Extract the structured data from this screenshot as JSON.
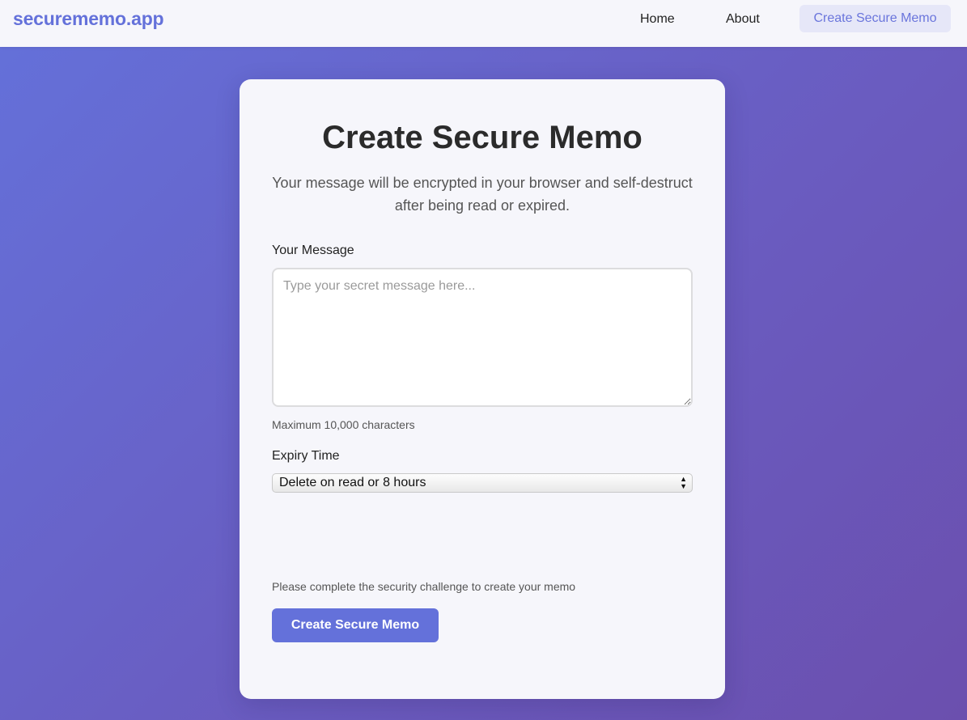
{
  "header": {
    "brand": "securememo.app",
    "nav": {
      "home": "Home",
      "about": "About",
      "create": "Create Secure Memo"
    }
  },
  "form": {
    "title": "Create Secure Memo",
    "subtitle": "Your message will be encrypted in your browser and self-destruct after being read or expired.",
    "message_label": "Your Message",
    "message_value": "",
    "message_placeholder": "Type your secret message here...",
    "message_hint": "Maximum 10,000 characters",
    "expiry_label": "Expiry Time",
    "expiry_selected": "Delete on read or 8 hours",
    "challenge_text": "Please complete the security challenge to create your memo",
    "submit_label": "Create Secure Memo"
  },
  "colors": {
    "accent": "#6471da",
    "nav_active_bg": "#e6e7f8",
    "card_bg": "#f6f6fb"
  }
}
